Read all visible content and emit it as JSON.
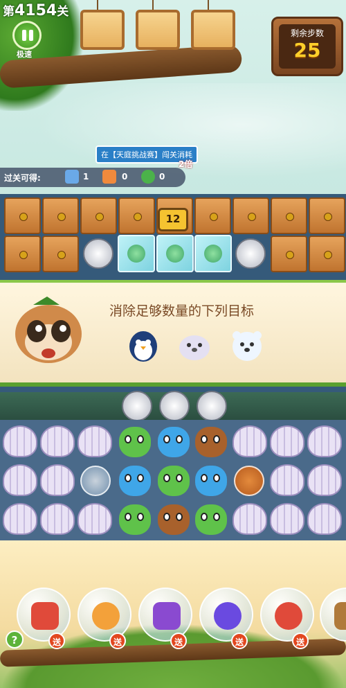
{
  "level": {
    "prefix": "第",
    "number": "4154",
    "suffix": "关"
  },
  "pause": {
    "label": "极速"
  },
  "moves": {
    "label": "剩余步数",
    "value": "25"
  },
  "event_banner": {
    "text": "在【天庭挑战赛】闯关消耗",
    "sub": "2倍"
  },
  "rewards": {
    "label": "过关可得:",
    "items": [
      {
        "icon": "gift-box-icon",
        "count": "1"
      },
      {
        "icon": "ticket-icon",
        "count": "0"
      },
      {
        "icon": "clover-icon",
        "count": "0"
      }
    ]
  },
  "board": {
    "timer_value": "12"
  },
  "goal_popup": {
    "title": "消除足够数量的下列目标",
    "targets": [
      "penguin-icon",
      "seal-icon",
      "polar-bear-icon"
    ]
  },
  "boosters": [
    {
      "icon": "color-grid-icon",
      "badge": "送"
    },
    {
      "icon": "clock-icon",
      "badge": "送"
    },
    {
      "icon": "bird-swap-icon",
      "badge": "送"
    },
    {
      "icon": "rocket-arrows-icon",
      "badge": "送"
    },
    {
      "icon": "up-rocket-icon",
      "badge": "送"
    },
    {
      "icon": "hammer-icon",
      "badge": ""
    }
  ],
  "help": {
    "label": "?"
  },
  "colors": {
    "moves_value": "#ffcf2a",
    "banner_bg": "#2a7fc7",
    "accent_green": "#5cb33a"
  }
}
